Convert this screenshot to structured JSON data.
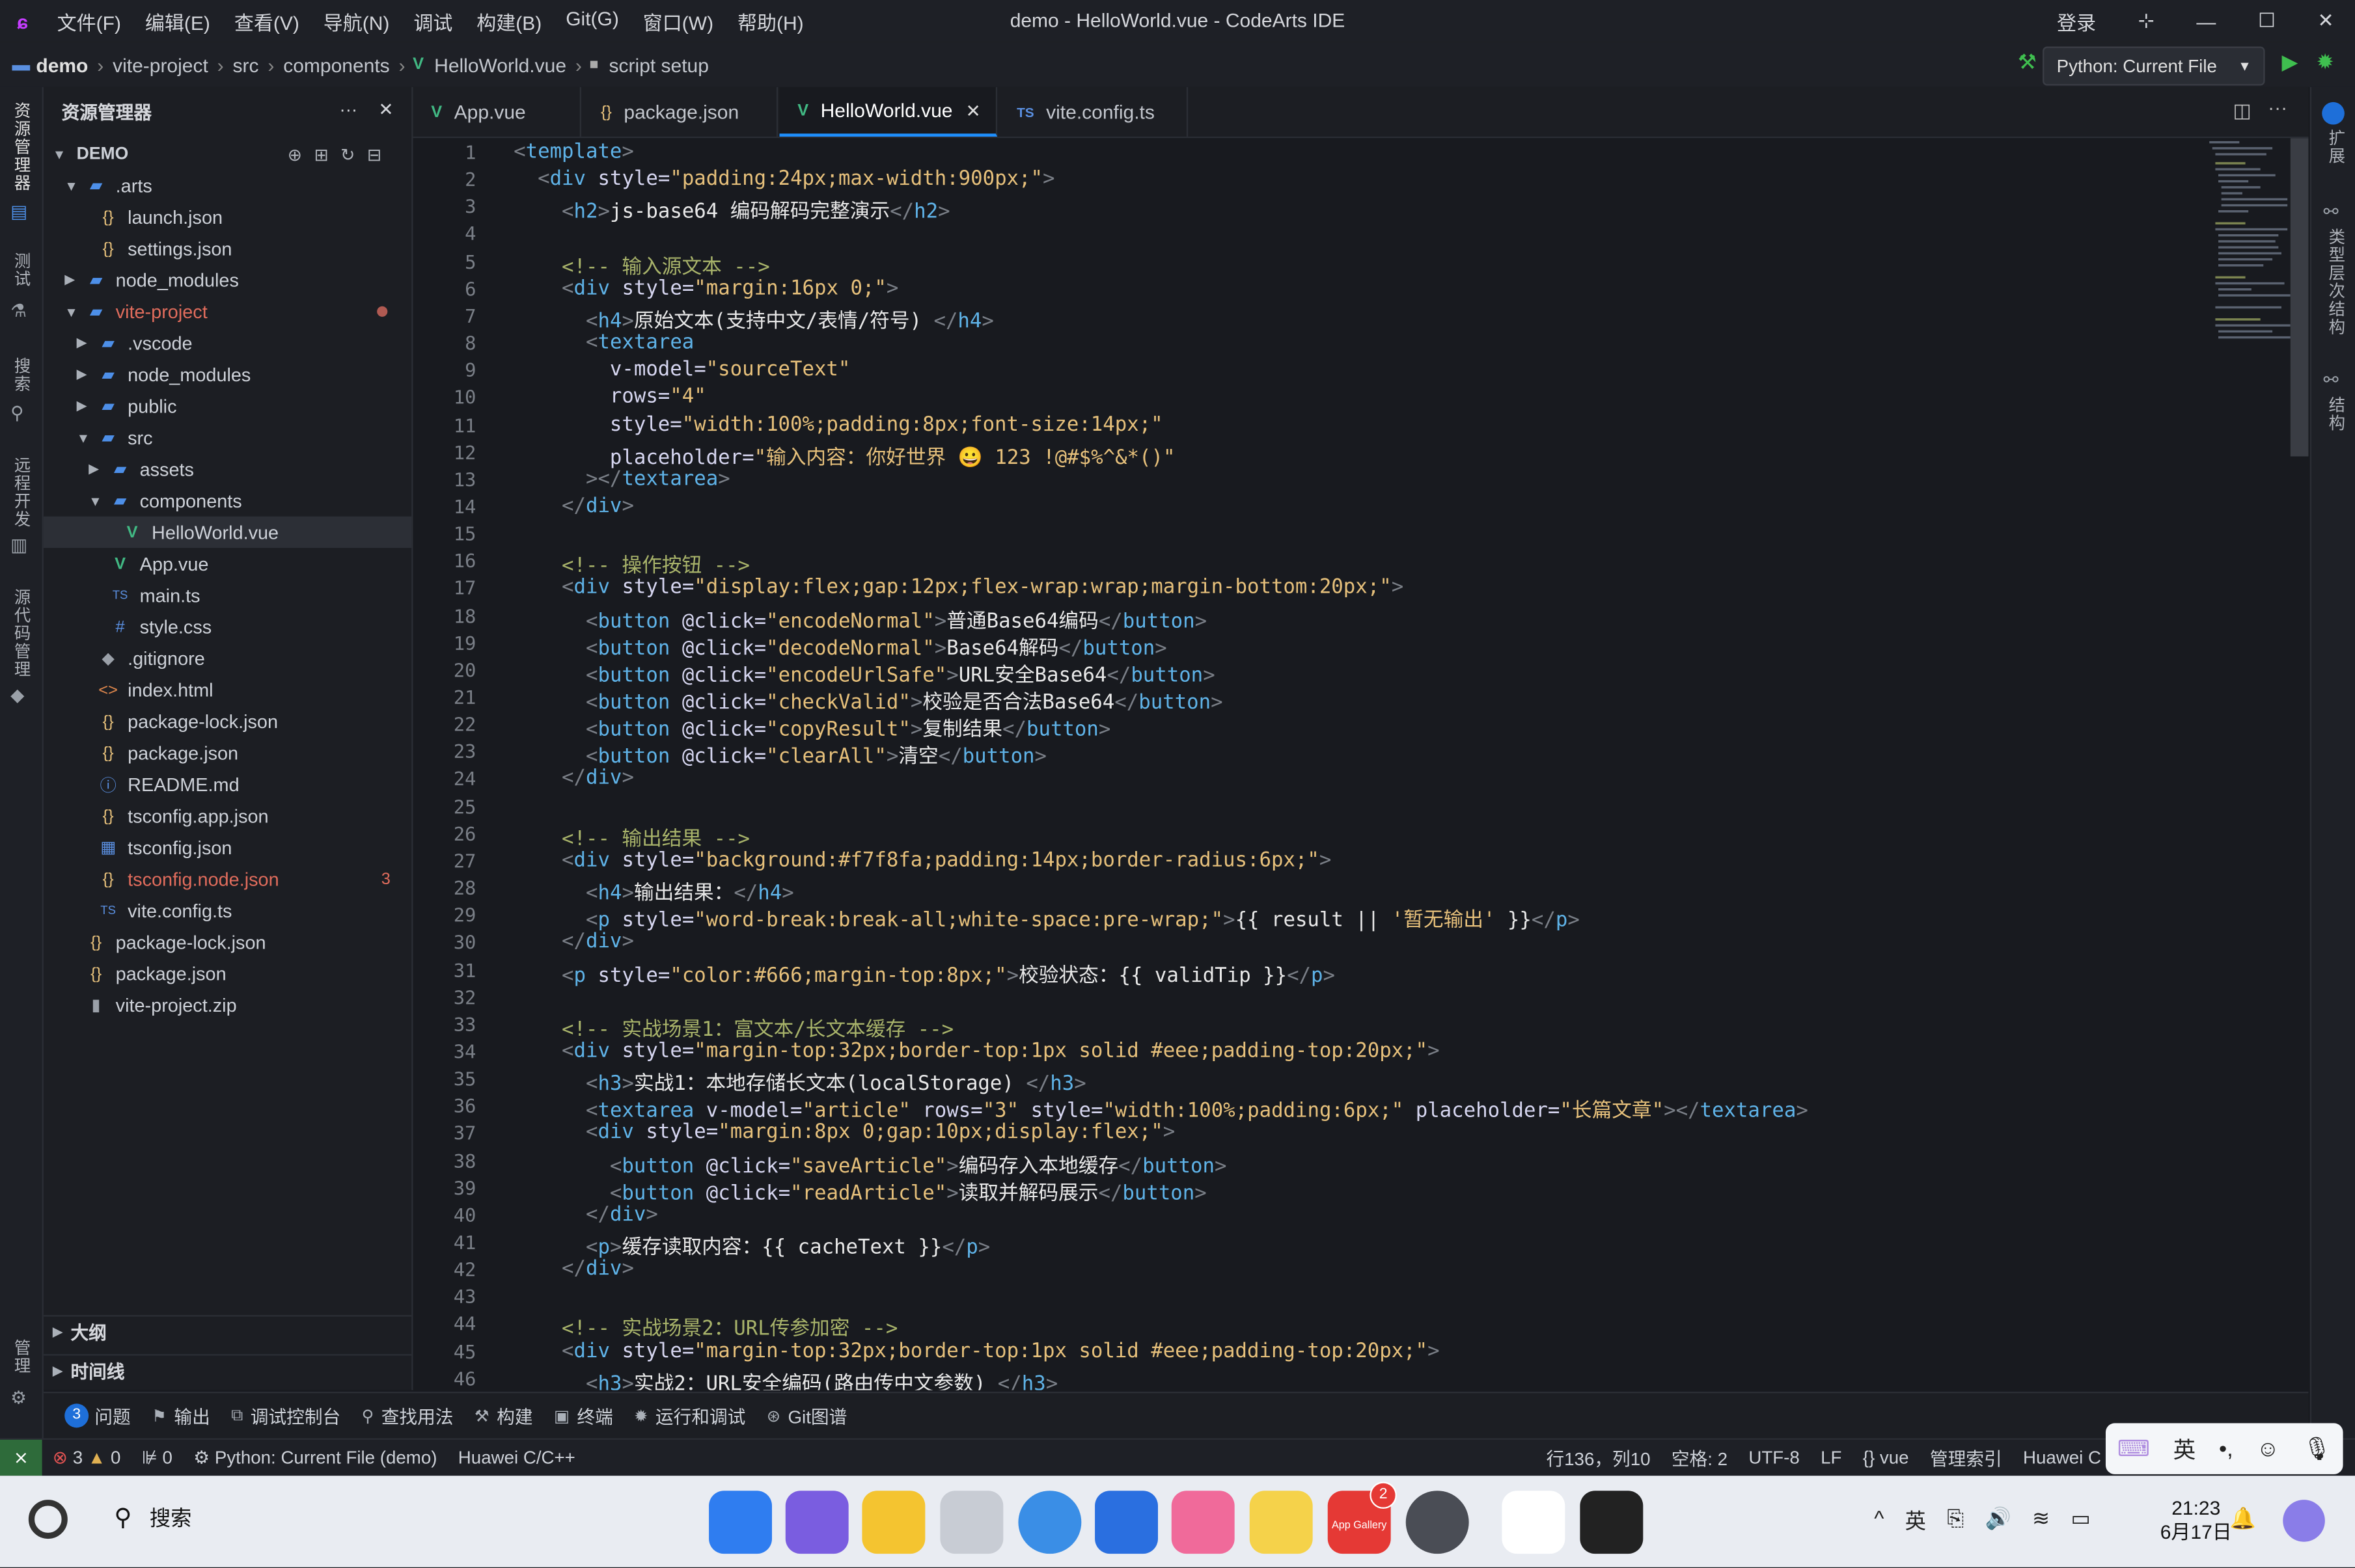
{
  "window": {
    "title": "demo - HelloWorld.vue - CodeArts IDE",
    "login": "登录",
    "menu": [
      "文件(F)",
      "编辑(E)",
      "查看(V)",
      "导航(N)",
      "调试",
      "构建(B)",
      "Git(G)",
      "窗口(W)",
      "帮助(H)"
    ]
  },
  "breadcrumb": [
    "demo",
    "vite-project",
    "src",
    "components",
    "HelloWorld.vue",
    "script setup"
  ],
  "run_config": "Python: Current File",
  "activity": [
    "资源管理器",
    "测试",
    "搜索",
    "远程开发",
    "源代码管理",
    "管理"
  ],
  "right_activity": [
    "扩展",
    "类型层次结构",
    "结构"
  ],
  "explorer": {
    "title": "资源管理器",
    "root": "DEMO",
    "tree": [
      {
        "label": ".arts",
        "depth": 1,
        "kind": "folder-open",
        "icon": "folder"
      },
      {
        "label": "launch.json",
        "depth": 2,
        "kind": "file",
        "icon": "{}"
      },
      {
        "label": "settings.json",
        "depth": 2,
        "kind": "file",
        "icon": "{}"
      },
      {
        "label": "node_modules",
        "depth": 1,
        "kind": "folder",
        "icon": "folder"
      },
      {
        "label": "vite-project",
        "depth": 1,
        "kind": "folder-open",
        "icon": "folder",
        "status": "modified"
      },
      {
        "label": ".vscode",
        "depth": 2,
        "kind": "folder",
        "icon": "folder"
      },
      {
        "label": "node_modules",
        "depth": 2,
        "kind": "folder",
        "icon": "folder"
      },
      {
        "label": "public",
        "depth": 2,
        "kind": "folder",
        "icon": "folder"
      },
      {
        "label": "src",
        "depth": 2,
        "kind": "folder-open",
        "icon": "folder"
      },
      {
        "label": "assets",
        "depth": 3,
        "kind": "folder",
        "icon": "folder"
      },
      {
        "label": "components",
        "depth": 3,
        "kind": "folder-open",
        "icon": "folder"
      },
      {
        "label": "HelloWorld.vue",
        "depth": 4,
        "kind": "file",
        "icon": "V",
        "selected": true
      },
      {
        "label": "App.vue",
        "depth": 3,
        "kind": "file",
        "icon": "V"
      },
      {
        "label": "main.ts",
        "depth": 3,
        "kind": "file",
        "icon": "TS"
      },
      {
        "label": "style.css",
        "depth": 3,
        "kind": "file",
        "icon": "#"
      },
      {
        "label": ".gitignore",
        "depth": 2,
        "kind": "file",
        "icon": "◆"
      },
      {
        "label": "index.html",
        "depth": 2,
        "kind": "file",
        "icon": "<>"
      },
      {
        "label": "package-lock.json",
        "depth": 2,
        "kind": "file",
        "icon": "{}"
      },
      {
        "label": "package.json",
        "depth": 2,
        "kind": "file",
        "icon": "{}"
      },
      {
        "label": "README.md",
        "depth": 2,
        "kind": "file",
        "icon": "ⓘ"
      },
      {
        "label": "tsconfig.app.json",
        "depth": 2,
        "kind": "file",
        "icon": "{}"
      },
      {
        "label": "tsconfig.json",
        "depth": 2,
        "kind": "file",
        "icon": "▦"
      },
      {
        "label": "tsconfig.node.json",
        "depth": 2,
        "kind": "file",
        "icon": "{}",
        "badge": "3"
      },
      {
        "label": "vite.config.ts",
        "depth": 2,
        "kind": "file",
        "icon": "TS"
      },
      {
        "label": "package-lock.json",
        "depth": 1,
        "kind": "file",
        "icon": "{}"
      },
      {
        "label": "package.json",
        "depth": 1,
        "kind": "file",
        "icon": "{}"
      },
      {
        "label": "vite-project.zip",
        "depth": 1,
        "kind": "file",
        "icon": "▮"
      }
    ],
    "outline": "大纲",
    "timeline": "时间线"
  },
  "tabs": [
    {
      "label": "App.vue",
      "icon": "V"
    },
    {
      "label": "package.json",
      "icon": "{}"
    },
    {
      "label": "HelloWorld.vue",
      "icon": "V",
      "active": true
    },
    {
      "label": "vite.config.ts",
      "icon": "TS"
    }
  ],
  "code": [
    [
      [
        "tg",
        "<"
      ],
      [
        "tn",
        "template"
      ],
      [
        "tg",
        ">"
      ]
    ],
    [
      [
        "tx",
        "  "
      ],
      [
        "tg",
        "<"
      ],
      [
        "tn",
        "div"
      ],
      [
        "an",
        " style="
      ],
      [
        "av",
        "\"padding:24px;max-width:900px;\""
      ],
      [
        "tg",
        ">"
      ]
    ],
    [
      [
        "tx",
        "    "
      ],
      [
        "tg",
        "<"
      ],
      [
        "tn",
        "h2"
      ],
      [
        "tg",
        ">"
      ],
      [
        "tx",
        "js-base64 编码解码完整演示"
      ],
      [
        "tg",
        "</"
      ],
      [
        "tn",
        "h2"
      ],
      [
        "tg",
        ">"
      ]
    ],
    [],
    [
      [
        "tx",
        "    "
      ],
      [
        "cm",
        "<!-- 输入源文本 -->"
      ]
    ],
    [
      [
        "tx",
        "    "
      ],
      [
        "tg",
        "<"
      ],
      [
        "tn",
        "div"
      ],
      [
        "an",
        " style="
      ],
      [
        "av",
        "\"margin:16px 0;\""
      ],
      [
        "tg",
        ">"
      ]
    ],
    [
      [
        "tx",
        "      "
      ],
      [
        "tg",
        "<"
      ],
      [
        "tn",
        "h4"
      ],
      [
        "tg",
        ">"
      ],
      [
        "tx",
        "原始文本(支持中文/表情/符号) "
      ],
      [
        "tg",
        "</"
      ],
      [
        "tn",
        "h4"
      ],
      [
        "tg",
        ">"
      ]
    ],
    [
      [
        "tx",
        "      "
      ],
      [
        "tg",
        "<"
      ],
      [
        "tn",
        "textarea"
      ]
    ],
    [
      [
        "tx",
        "        "
      ],
      [
        "an",
        "v-model="
      ],
      [
        "av",
        "\"sourceText\""
      ]
    ],
    [
      [
        "tx",
        "        "
      ],
      [
        "an",
        "rows="
      ],
      [
        "av",
        "\"4\""
      ]
    ],
    [
      [
        "tx",
        "        "
      ],
      [
        "an",
        "style="
      ],
      [
        "av",
        "\"width:100%;padding:8px;font-size:14px;\""
      ]
    ],
    [
      [
        "tx",
        "        "
      ],
      [
        "an",
        "placeholder="
      ],
      [
        "av",
        "\"输入内容：你好世界 😀 123 !@#$%^&*()\""
      ]
    ],
    [
      [
        "tx",
        "      "
      ],
      [
        "tg",
        "></"
      ],
      [
        "tn",
        "textarea"
      ],
      [
        "tg",
        ">"
      ]
    ],
    [
      [
        "tx",
        "    "
      ],
      [
        "tg",
        "</"
      ],
      [
        "tn",
        "div"
      ],
      [
        "tg",
        ">"
      ]
    ],
    [],
    [
      [
        "tx",
        "    "
      ],
      [
        "cm",
        "<!-- 操作按钮 -->"
      ]
    ],
    [
      [
        "tx",
        "    "
      ],
      [
        "tg",
        "<"
      ],
      [
        "tn",
        "div"
      ],
      [
        "an",
        " style="
      ],
      [
        "av",
        "\"display:flex;gap:12px;flex-wrap:wrap;margin-bottom:20px;\""
      ],
      [
        "tg",
        ">"
      ]
    ],
    [
      [
        "tx",
        "      "
      ],
      [
        "tg",
        "<"
      ],
      [
        "tn",
        "button"
      ],
      [
        "an",
        " @click="
      ],
      [
        "av",
        "\"encodeNormal\""
      ],
      [
        "tg",
        ">"
      ],
      [
        "tx",
        "普通Base64编码"
      ],
      [
        "tg",
        "</"
      ],
      [
        "tn",
        "button"
      ],
      [
        "tg",
        ">"
      ]
    ],
    [
      [
        "tx",
        "      "
      ],
      [
        "tg",
        "<"
      ],
      [
        "tn",
        "button"
      ],
      [
        "an",
        " @click="
      ],
      [
        "av",
        "\"decodeNormal\""
      ],
      [
        "tg",
        ">"
      ],
      [
        "tx",
        "Base64解码"
      ],
      [
        "tg",
        "</"
      ],
      [
        "tn",
        "button"
      ],
      [
        "tg",
        ">"
      ]
    ],
    [
      [
        "tx",
        "      "
      ],
      [
        "tg",
        "<"
      ],
      [
        "tn",
        "button"
      ],
      [
        "an",
        " @click="
      ],
      [
        "av",
        "\"encodeUrlSafe\""
      ],
      [
        "tg",
        ">"
      ],
      [
        "tx",
        "URL安全Base64"
      ],
      [
        "tg",
        "</"
      ],
      [
        "tn",
        "button"
      ],
      [
        "tg",
        ">"
      ]
    ],
    [
      [
        "tx",
        "      "
      ],
      [
        "tg",
        "<"
      ],
      [
        "tn",
        "button"
      ],
      [
        "an",
        " @click="
      ],
      [
        "av",
        "\"checkValid\""
      ],
      [
        "tg",
        ">"
      ],
      [
        "tx",
        "校验是否合法Base64"
      ],
      [
        "tg",
        "</"
      ],
      [
        "tn",
        "button"
      ],
      [
        "tg",
        ">"
      ]
    ],
    [
      [
        "tx",
        "      "
      ],
      [
        "tg",
        "<"
      ],
      [
        "tn",
        "button"
      ],
      [
        "an",
        " @click="
      ],
      [
        "av",
        "\"copyResult\""
      ],
      [
        "tg",
        ">"
      ],
      [
        "tx",
        "复制结果"
      ],
      [
        "tg",
        "</"
      ],
      [
        "tn",
        "button"
      ],
      [
        "tg",
        ">"
      ]
    ],
    [
      [
        "tx",
        "      "
      ],
      [
        "tg",
        "<"
      ],
      [
        "tn",
        "button"
      ],
      [
        "an",
        " @click="
      ],
      [
        "av",
        "\"clearAll\""
      ],
      [
        "tg",
        ">"
      ],
      [
        "tx",
        "清空"
      ],
      [
        "tg",
        "</"
      ],
      [
        "tn",
        "button"
      ],
      [
        "tg",
        ">"
      ]
    ],
    [
      [
        "tx",
        "    "
      ],
      [
        "tg",
        "</"
      ],
      [
        "tn",
        "div"
      ],
      [
        "tg",
        ">"
      ]
    ],
    [],
    [
      [
        "tx",
        "    "
      ],
      [
        "cm",
        "<!-- 输出结果 -->"
      ]
    ],
    [
      [
        "tx",
        "    "
      ],
      [
        "tg",
        "<"
      ],
      [
        "tn",
        "div"
      ],
      [
        "an",
        " style="
      ],
      [
        "av",
        "\"background:#f7f8fa;padding:14px;border-radius:6px;\""
      ],
      [
        "tg",
        ">"
      ]
    ],
    [
      [
        "tx",
        "      "
      ],
      [
        "tg",
        "<"
      ],
      [
        "tn",
        "h4"
      ],
      [
        "tg",
        ">"
      ],
      [
        "tx",
        "输出结果："
      ],
      [
        "tg",
        "</"
      ],
      [
        "tn",
        "h4"
      ],
      [
        "tg",
        ">"
      ]
    ],
    [
      [
        "tx",
        "      "
      ],
      [
        "tg",
        "<"
      ],
      [
        "tn",
        "p"
      ],
      [
        "an",
        " style="
      ],
      [
        "av",
        "\"word-break:break-all;white-space:pre-wrap;\""
      ],
      [
        "tg",
        ">"
      ],
      [
        "tx",
        "{{ result || "
      ],
      [
        "av",
        "'暂无输出'"
      ],
      [
        "tx",
        " }}"
      ],
      [
        "tg",
        "</"
      ],
      [
        "tn",
        "p"
      ],
      [
        "tg",
        ">"
      ]
    ],
    [
      [
        "tx",
        "    "
      ],
      [
        "tg",
        "</"
      ],
      [
        "tn",
        "div"
      ],
      [
        "tg",
        ">"
      ]
    ],
    [
      [
        "tx",
        "    "
      ],
      [
        "tg",
        "<"
      ],
      [
        "tn",
        "p"
      ],
      [
        "an",
        " style="
      ],
      [
        "av",
        "\"color:#666;margin-top:8px;\""
      ],
      [
        "tg",
        ">"
      ],
      [
        "tx",
        "校验状态：{{ validTip }}"
      ],
      [
        "tg",
        "</"
      ],
      [
        "tn",
        "p"
      ],
      [
        "tg",
        ">"
      ]
    ],
    [],
    [
      [
        "tx",
        "    "
      ],
      [
        "cm",
        "<!-- 实战场景1：富文本/长文本缓存 -->"
      ]
    ],
    [
      [
        "tx",
        "    "
      ],
      [
        "tg",
        "<"
      ],
      [
        "tn",
        "div"
      ],
      [
        "an",
        " style="
      ],
      [
        "av",
        "\"margin-top:32px;border-top:1px solid #eee;padding-top:20px;\""
      ],
      [
        "tg",
        ">"
      ]
    ],
    [
      [
        "tx",
        "      "
      ],
      [
        "tg",
        "<"
      ],
      [
        "tn",
        "h3"
      ],
      [
        "tg",
        ">"
      ],
      [
        "tx",
        "实战1：本地存储长文本(localStorage) "
      ],
      [
        "tg",
        "</"
      ],
      [
        "tn",
        "h3"
      ],
      [
        "tg",
        ">"
      ]
    ],
    [
      [
        "tx",
        "      "
      ],
      [
        "tg",
        "<"
      ],
      [
        "tn",
        "textarea"
      ],
      [
        "an",
        " v-model="
      ],
      [
        "av",
        "\"article\""
      ],
      [
        "an",
        " rows="
      ],
      [
        "av",
        "\"3\""
      ],
      [
        "an",
        " style="
      ],
      [
        "av",
        "\"width:100%;padding:6px;\""
      ],
      [
        "an",
        " placeholder="
      ],
      [
        "av",
        "\"长篇文章\""
      ],
      [
        "tg",
        "></"
      ],
      [
        "tn",
        "textarea"
      ],
      [
        "tg",
        ">"
      ]
    ],
    [
      [
        "tx",
        "      "
      ],
      [
        "tg",
        "<"
      ],
      [
        "tn",
        "div"
      ],
      [
        "an",
        " style="
      ],
      [
        "av",
        "\"margin:8px 0;gap:10px;display:flex;\""
      ],
      [
        "tg",
        ">"
      ]
    ],
    [
      [
        "tx",
        "        "
      ],
      [
        "tg",
        "<"
      ],
      [
        "tn",
        "button"
      ],
      [
        "an",
        " @click="
      ],
      [
        "av",
        "\"saveArticle\""
      ],
      [
        "tg",
        ">"
      ],
      [
        "tx",
        "编码存入本地缓存"
      ],
      [
        "tg",
        "</"
      ],
      [
        "tn",
        "button"
      ],
      [
        "tg",
        ">"
      ]
    ],
    [
      [
        "tx",
        "        "
      ],
      [
        "tg",
        "<"
      ],
      [
        "tn",
        "button"
      ],
      [
        "an",
        " @click="
      ],
      [
        "av",
        "\"readArticle\""
      ],
      [
        "tg",
        ">"
      ],
      [
        "tx",
        "读取并解码展示"
      ],
      [
        "tg",
        "</"
      ],
      [
        "tn",
        "button"
      ],
      [
        "tg",
        ">"
      ]
    ],
    [
      [
        "tx",
        "      "
      ],
      [
        "tg",
        "</"
      ],
      [
        "tn",
        "div"
      ],
      [
        "tg",
        ">"
      ]
    ],
    [
      [
        "tx",
        "      "
      ],
      [
        "tg",
        "<"
      ],
      [
        "tn",
        "p"
      ],
      [
        "tg",
        ">"
      ],
      [
        "tx",
        "缓存读取内容：{{ cacheText }}"
      ],
      [
        "tg",
        "</"
      ],
      [
        "tn",
        "p"
      ],
      [
        "tg",
        ">"
      ]
    ],
    [
      [
        "tx",
        "    "
      ],
      [
        "tg",
        "</"
      ],
      [
        "tn",
        "div"
      ],
      [
        "tg",
        ">"
      ]
    ],
    [],
    [
      [
        "tx",
        "    "
      ],
      [
        "cm",
        "<!-- 实战场景2：URL传参加密 -->"
      ]
    ],
    [
      [
        "tx",
        "    "
      ],
      [
        "tg",
        "<"
      ],
      [
        "tn",
        "div"
      ],
      [
        "an",
        " style="
      ],
      [
        "av",
        "\"margin-top:32px;border-top:1px solid #eee;padding-top:20px;\""
      ],
      [
        "tg",
        ">"
      ]
    ],
    [
      [
        "tx",
        "      "
      ],
      [
        "tg",
        "<"
      ],
      [
        "tn",
        "h3"
      ],
      [
        "tg",
        ">"
      ],
      [
        "tx",
        "实战2：URL安全编码(路由传中文参数) "
      ],
      [
        "tg",
        "</"
      ],
      [
        "tn",
        "h3"
      ],
      [
        "tg",
        ">"
      ]
    ]
  ],
  "panel": {
    "problems_count": "3",
    "tabs": [
      "问题",
      "输出",
      "调试控制台",
      "查找用法",
      "构建",
      "终端",
      "运行和调试",
      "Git图谱"
    ]
  },
  "status": {
    "errors": "3",
    "warnings": "0",
    "ports": "0",
    "run": "Python: Current File (demo)",
    "lang_server": "Huawei C/C++",
    "position": "行136，列10",
    "indent": "空格: 2",
    "encoding": "UTF-8",
    "eol": "LF",
    "mode": "vue",
    "index": "管理索引",
    "right_cut": "Huawei C"
  },
  "ime": {
    "lang": "英"
  },
  "taskbar": {
    "search": "搜索",
    "gallery_badge": "2",
    "gallery_label": "App Gallery",
    "tray_lang": "英",
    "time": "21:23",
    "date": "6月17日"
  }
}
